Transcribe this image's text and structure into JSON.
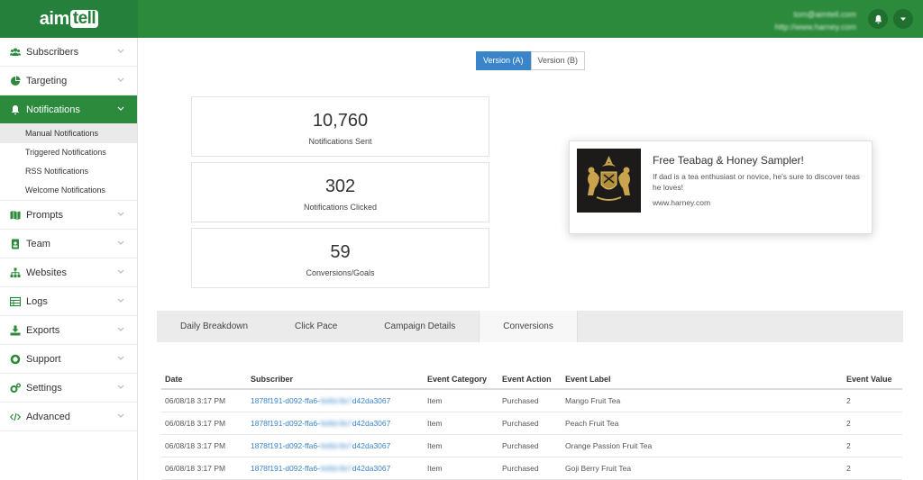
{
  "app": {
    "logo_prefix": "aim",
    "logo_boxed": "tell"
  },
  "user": {
    "email": "tom@aimtell.com",
    "site": "http://www.harney.com"
  },
  "sidebar": {
    "items": [
      {
        "label": "Subscribers",
        "icon": "users-icon"
      },
      {
        "label": "Targeting",
        "icon": "pie-chart-icon"
      },
      {
        "label": "Notifications",
        "icon": "bell-icon",
        "active": true
      },
      {
        "label": "Prompts",
        "icon": "map-icon"
      },
      {
        "label": "Team",
        "icon": "id-card-icon"
      },
      {
        "label": "Websites",
        "icon": "sitemap-icon"
      },
      {
        "label": "Logs",
        "icon": "table-icon"
      },
      {
        "label": "Exports",
        "icon": "download-icon"
      },
      {
        "label": "Support",
        "icon": "life-ring-icon"
      },
      {
        "label": "Settings",
        "icon": "cogs-icon"
      },
      {
        "label": "Advanced",
        "icon": "code-icon"
      }
    ],
    "subitems": [
      "Manual Notifications",
      "Triggered Notifications",
      "RSS Notifications",
      "Welcome Notifications"
    ]
  },
  "versions": [
    "Version (A)",
    "Version (B)"
  ],
  "stats": [
    {
      "value": "10,760",
      "label": "Notifications Sent"
    },
    {
      "value": "302",
      "label": "Notifications Clicked"
    },
    {
      "value": "59",
      "label": "Conversions/Goals"
    }
  ],
  "preview": {
    "title": "Free Teabag & Honey Sampler!",
    "body": "If dad is a tea enthusiast or novice, he's sure to discover teas he loves!",
    "url": "www.harney.com"
  },
  "tabs": [
    "Daily Breakdown",
    "Click Pace",
    "Campaign Details",
    "Conversions"
  ],
  "table": {
    "headers": [
      "Date",
      "Subscriber",
      "Event Category",
      "Event Action",
      "Event Label",
      "Event Value"
    ],
    "rows": [
      {
        "date": "06/08/18 3:17 PM",
        "sub_a": "1878f191-d092-ffa6-",
        "sub_b": "4e8d-8e7",
        "sub_c": "d42da3067",
        "category": "Item",
        "action": "Purchased",
        "label": "Mango Fruit Tea",
        "value": "2"
      },
      {
        "date": "06/08/18 3:17 PM",
        "sub_a": "1878f191-d092-ffa6-",
        "sub_b": "4e8d-8e7",
        "sub_c": "d42da3067",
        "category": "Item",
        "action": "Purchased",
        "label": "Peach Fruit Tea",
        "value": "2"
      },
      {
        "date": "06/08/18 3:17 PM",
        "sub_a": "1878f191-d092-ffa6-",
        "sub_b": "4e8d-8e7",
        "sub_c": "d42da3067",
        "category": "Item",
        "action": "Purchased",
        "label": "Orange Passion Fruit Tea",
        "value": "2"
      },
      {
        "date": "06/08/18 3:17 PM",
        "sub_a": "1878f191-d092-ffa6-",
        "sub_b": "4e8d-8e7",
        "sub_c": "d42da3067",
        "category": "Item",
        "action": "Purchased",
        "label": "Goji Berry Fruit Tea",
        "value": "2"
      }
    ]
  },
  "colors": {
    "brand_green": "#2b8a3b",
    "link_blue": "#3a85c9"
  }
}
